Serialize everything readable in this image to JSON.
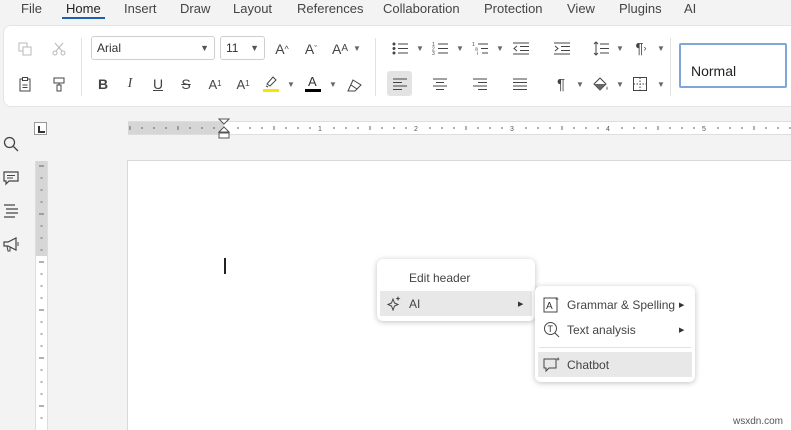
{
  "menubar": {
    "items": [
      "File",
      "Home",
      "Insert",
      "Draw",
      "Layout",
      "References",
      "Collaboration",
      "Protection",
      "View",
      "Plugins",
      "AI"
    ],
    "active": "Home"
  },
  "ribbon": {
    "font_name": "Arial",
    "font_size": "11",
    "style": "Normal"
  },
  "context_menu": {
    "items": [
      "Edit header",
      "AI"
    ]
  },
  "ai_submenu": {
    "items": [
      "Grammar & Spelling",
      "Text analysis",
      "Chatbot"
    ]
  },
  "watermark": "wsxdn.com",
  "colors": {
    "accent": "#1f5fb0",
    "highlight_swatch": "#f6e600",
    "font_color_swatch": "#000000",
    "style_border": "#7ea6d8"
  },
  "icons": [
    "copy-icon",
    "cut-icon",
    "paste-icon",
    "format-painter-icon",
    "bold-icon",
    "italic-icon",
    "underline-icon",
    "strikethrough-icon",
    "superscript-icon",
    "subscript-icon",
    "highlight-icon",
    "font-color-icon",
    "clear-format-icon",
    "grow-font-icon",
    "shrink-font-icon",
    "change-case-icon",
    "bullet-list-icon",
    "numbered-list-icon",
    "multilevel-list-icon",
    "decrease-indent-icon",
    "increase-indent-icon",
    "line-spacing-icon",
    "paragraph-direction-icon",
    "align-left-icon",
    "align-center-icon",
    "align-right-icon",
    "justify-icon",
    "show-marks-icon",
    "shading-icon",
    "borders-icon",
    "search-icon",
    "comment-icon",
    "headings-icon",
    "announcement-icon",
    "ai-sparkle-icon",
    "grammar-icon",
    "text-analysis-icon",
    "chatbot-icon"
  ]
}
